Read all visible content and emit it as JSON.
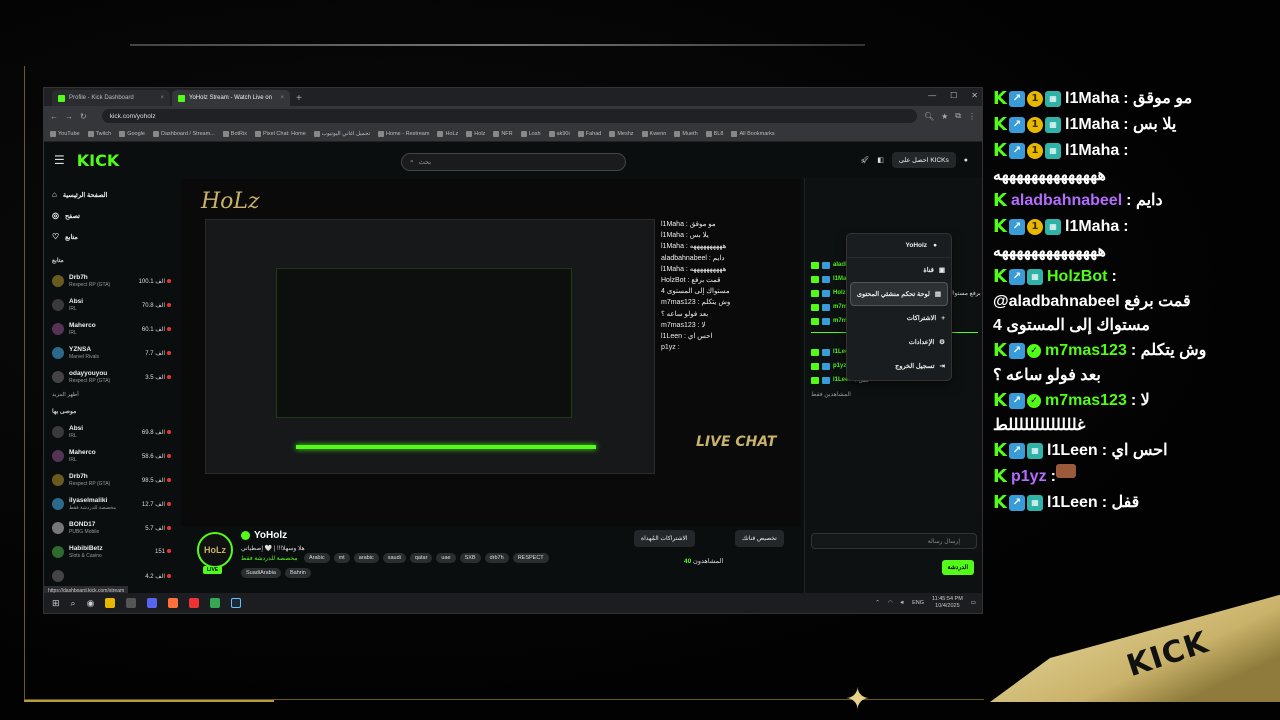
{
  "browser": {
    "tabs": [
      {
        "label": "Profile - Kick Dashboard",
        "active": false
      },
      {
        "label": "YoHolz Stream - Watch Live on",
        "active": true
      }
    ],
    "url": "kick.com/yoholz",
    "bookmarks": [
      "YouTube",
      "Twitch",
      "Google",
      "Dashboard / Stream...",
      "BotRix",
      "Pixel Chat: Home",
      "تحميل اغاني اليوتيوب",
      "Home - Restream",
      "HoLz",
      "Holz",
      "NFR",
      "Losh",
      "ak90i",
      "Fahad",
      "Meshz",
      "Kwenn",
      "Mueth",
      "BL8",
      "All Bookmarks"
    ],
    "status_url": "https://dashboard.kick.com/stream"
  },
  "kick": {
    "logo": "KICK",
    "search_placeholder": "بحث",
    "get_kicks": "احصل على KICKs",
    "nav": [
      {
        "label": "الصفحة الرئيسية",
        "icon": "home-icon"
      },
      {
        "label": "تصفح",
        "icon": "compass-icon"
      },
      {
        "label": "متابع",
        "icon": "heart-icon"
      }
    ],
    "following_title": "متابع",
    "following": [
      {
        "name": "Drb7h",
        "category": "Respect RP (GTA)",
        "viewers": "100.1 الف"
      },
      {
        "name": "Absi",
        "category": "IRL",
        "viewers": "70.8 الف"
      },
      {
        "name": "Maherco",
        "category": "IRL",
        "viewers": "60.1 الف"
      },
      {
        "name": "YZNSA",
        "category": "Marvel Rivals",
        "viewers": "7.7 الف"
      },
      {
        "name": "odayyouyou",
        "category": "Respect RP (GTA)",
        "viewers": "3.5 الف"
      }
    ],
    "show_more": "أظهر المزيد",
    "recommended_title": "موصى بها",
    "recommended": [
      {
        "name": "Absi",
        "category": "IRL",
        "viewers": "69.8 الف"
      },
      {
        "name": "Maherco",
        "category": "IRL",
        "viewers": "58.6 الف"
      },
      {
        "name": "Drb7h",
        "category": "Respect RP (GTA)",
        "viewers": "98.5 الف"
      },
      {
        "name": "ilyaselmaliki",
        "category": "مخصصة للدردشة فقط",
        "viewers": "12.7 الف"
      },
      {
        "name": "BOND17",
        "category": "PUBG Mobile",
        "viewers": "5.7 الف"
      },
      {
        "name": "HabibiBetz",
        "category": "Slots & Casino",
        "viewers": "151"
      },
      {
        "name": "",
        "category": "",
        "viewers": "4.2 الف"
      }
    ],
    "stream": {
      "streamer": "YoHolz",
      "title": "هلا وسهلا!!! | 🤍 إصطياتي",
      "category": "مخصصة للدردشة فقط",
      "live": "LIVE",
      "tags": [
        "Arabic",
        "mt",
        "arabic",
        "saudi",
        "qatar",
        "uae",
        "SXB",
        "drb7h",
        "RESPECT"
      ],
      "tags2": [
        "SuadiArabia",
        "Bahrin"
      ],
      "viewers_label": "المشاهدون",
      "viewers": "40",
      "btn_customize": "تخصيص قناتك",
      "btn_subs": "الاشتراكات المُهداة"
    },
    "dropdown": {
      "username": "YoHolz",
      "items": [
        {
          "label": "قناة",
          "icon": "channel-icon"
        },
        {
          "label": "لوحة تحكم منشئي المحتوى",
          "icon": "dashboard-icon"
        },
        {
          "label": "الاشتراكات",
          "icon": "plus-icon"
        },
        {
          "label": "الإعدادات",
          "icon": "gear-icon"
        },
        {
          "label": "تسجيل الخروج",
          "icon": "logout-icon"
        }
      ]
    },
    "chat": {
      "rows": [
        {
          "user": "aladbahnabeel",
          "text": ": دايم"
        },
        {
          "user": "l1Maha",
          "text": ": هههههههههه"
        },
        {
          "user": "HolzBot",
          "text": ": @aladbahnabeel قمت برفع مستواك إلى المستوى 4"
        },
        {
          "user": "m7mas123",
          "text": ": وش يتكلم بعد فولو ساعه ؟"
        },
        {
          "user": "m7mas123",
          "text": ": لا"
        }
      ],
      "new_messages": "رسائل جديدة",
      "rows2": [
        {
          "user": "l1Leen",
          "text": ": احس اي"
        },
        {
          "user": "p1yz",
          "text": ":"
        },
        {
          "user": "l1Leen",
          "text": ": قفل"
        }
      ],
      "pinned_label": "المشاهدين فقط",
      "input_placeholder": "إرسال رسالة",
      "send": "الدردشة"
    }
  },
  "taskbar": {
    "lang": "ENG",
    "time": "11:45:54 PM",
    "date": "10/4/2025"
  },
  "overlay": {
    "messages": [
      {
        "user": "l1Maha",
        "text": ": مو موقق",
        "badges": [
          "k",
          "up",
          "1",
          "bot"
        ],
        "color": "white"
      },
      {
        "user": "l1Maha",
        "text": ": يلا بس",
        "badges": [
          "k",
          "up",
          "1",
          "bot"
        ],
        "color": "white"
      },
      {
        "user": "l1Maha",
        "text": ":",
        "text2": "ههههههههههههههه",
        "badges": [
          "k",
          "up",
          "1",
          "bot"
        ],
        "color": "white"
      },
      {
        "user": "aladbahnabeel",
        "text": ": دايم",
        "badges": [
          "k"
        ],
        "color": "purple"
      },
      {
        "user": "l1Maha",
        "text": ":",
        "text2": "ههههههههههههههه",
        "badges": [
          "k",
          "up",
          "1",
          "bot"
        ],
        "color": "white"
      },
      {
        "user": "HolzBot",
        "text": ":",
        "text2": "@aladbahnabeel قمت برفع",
        "text3": "مستواك إلى المستوى 4",
        "badges": [
          "k",
          "up",
          "bot"
        ],
        "color": "green"
      },
      {
        "user": "m7mas123",
        "text": ": وش يتكلم",
        "text2": "بعد فولو ساعه ؟",
        "badges": [
          "k",
          "up",
          "gem"
        ],
        "color": "green"
      },
      {
        "user": "m7mas123",
        "text": ": لا",
        "text2": "غلللللللللللللط",
        "badges": [
          "k",
          "up",
          "gem"
        ],
        "color": "green"
      },
      {
        "user": "l1Leen",
        "text": ": احس اي",
        "badges": [
          "k",
          "up",
          "bot"
        ],
        "color": "white"
      },
      {
        "user": "p1yz",
        "text": ":",
        "badges": [
          "k"
        ],
        "color": "purple",
        "image": true
      },
      {
        "user": "l1Leen",
        "text": ": قفل",
        "badges": [
          "k",
          "up",
          "bot"
        ],
        "color": "white"
      }
    ]
  },
  "video": {
    "watermark": "HoLz",
    "live_chat": "LIVE CHAT",
    "mini_chat": [
      "l1Maha : مو موقق",
      "l1Maha : يلا بس",
      "l1Maha : ههههههههههه",
      "aladbahnabeel : دايم",
      "l1Maha : ههههههههههه",
      "HolzBot : قمت برفع",
      "مستواك إلى المستوى 4",
      "m7mas123 : وش يتكلم",
      "بعد فولو ساعه ؟",
      "m7mas123 : لا",
      "l1Leen : احس اي",
      "p1yz :"
    ]
  },
  "decor": {
    "corner_text": "KICK"
  }
}
